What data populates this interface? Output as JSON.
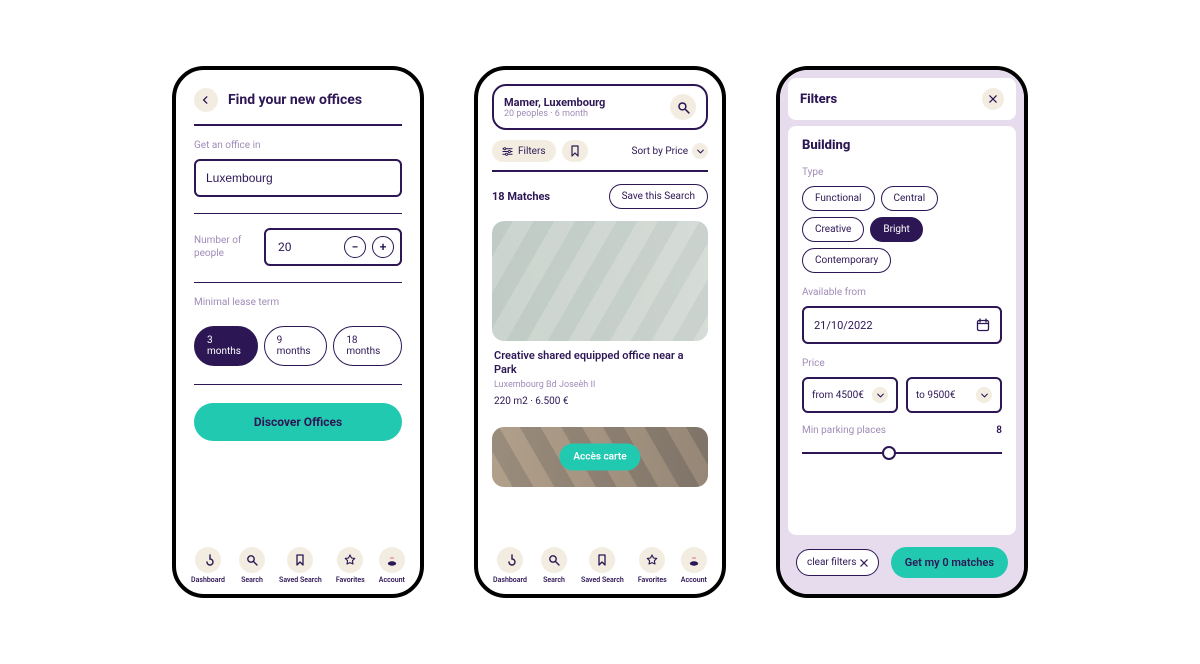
{
  "colors": {
    "primary": "#2c1654",
    "accent": "#22c9b1",
    "muted": "#a08cb8",
    "sand": "#f3ede1",
    "lilac": "#e7dced"
  },
  "tabs": [
    {
      "key": "dashboard",
      "label": "Dashboard"
    },
    {
      "key": "search",
      "label": "Search"
    },
    {
      "key": "saved",
      "label": "Saved Search"
    },
    {
      "key": "fav",
      "label": "Favorites"
    },
    {
      "key": "account",
      "label": "Account"
    }
  ],
  "p1": {
    "title": "Find your new offices",
    "loc_label": "Get an office in",
    "loc_value": "Luxembourg",
    "people_label_a": "Number of",
    "people_label_b": "people",
    "people_value": "20",
    "lease_label": "Minimal lease term",
    "lease_options": [
      "3 months",
      "9 months",
      "18 months"
    ],
    "lease_selected": 0,
    "cta": "Discover Offices"
  },
  "p2": {
    "search_location": "Mamer, Luxembourg",
    "search_sub": "20 peoples · 6 month",
    "filters_label": "Filters",
    "sort_label": "Sort by Price",
    "matches": "18 Matches",
    "save_label": "Save this Search",
    "card": {
      "title": "Creative shared equipped office near a Park",
      "sub": "Luxembourg  Bd Joseèh II",
      "meta": "220 m2   ·   6.500 €"
    },
    "map_btn": "Accès carte"
  },
  "p3": {
    "title": "Filters",
    "section": "Building",
    "type_label": "Type",
    "types": [
      {
        "label": "Functional",
        "sel": false
      },
      {
        "label": "Central",
        "sel": false
      },
      {
        "label": "Creative",
        "sel": false
      },
      {
        "label": "Bright",
        "sel": true
      },
      {
        "label": "Contemporary",
        "sel": false
      }
    ],
    "avail_label": "Available from",
    "avail_value": "21/10/2022",
    "price_label": "Price",
    "price_from": "from 4500€",
    "price_to": "to 9500€",
    "park_label": "Min parking places",
    "park_value": "8",
    "clear": "clear filters",
    "get": "Get my 0 matches"
  }
}
